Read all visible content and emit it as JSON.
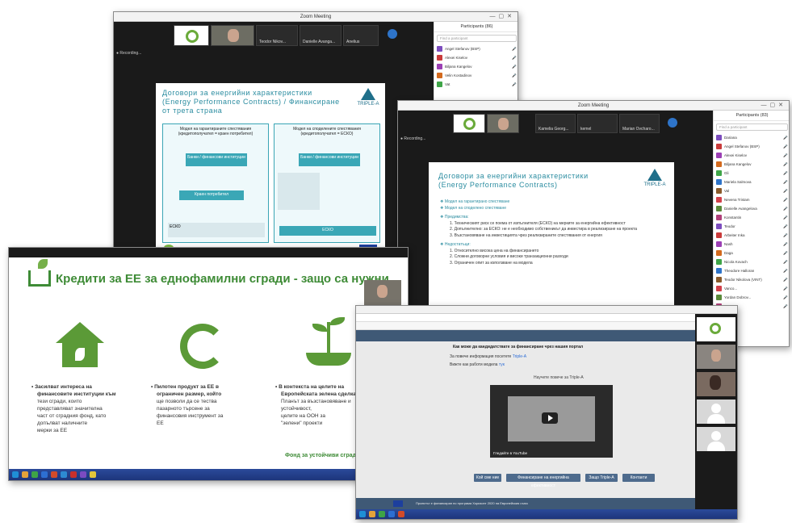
{
  "window_title": "Zoom Meeting",
  "win1": {
    "thumbs": [
      "",
      "",
      "Teodor Nikov...",
      "Danielle Avanga...",
      "Anelius"
    ],
    "recording": "Recording...",
    "participants_title": "Participants (86)",
    "search_placeholder": "Find a participant",
    "participants": [
      "Angel Stefanov (BSP)",
      "Alexei Kiselov",
      "Biljana Kangelov",
      "Velin Kostadinov",
      "Vat"
    ],
    "slide_title_1": "Договори за енергийни характеристики",
    "slide_title_2": "(Energy Performance Contracts) / Финансиране",
    "slide_title_3": "от трета страна",
    "logo": "TRIPLE-A",
    "model_left": "Модел на гарантираните спестявания (кредитополучател = краен потребител)",
    "model_right": "Модел на споделените спестявания (кредитополучател = ЕСКО)",
    "bank_label": "Банки / финансови институции",
    "end_user": "Краен потребител",
    "esco": "ЕСКО",
    "esco2": "ЕСКО"
  },
  "win2": {
    "thumbs": [
      "",
      "Kamelia Georg...",
      "kemel",
      "Marian Ovcharo..."
    ],
    "recording": "Recording...",
    "participants_title": "Participants (83)",
    "search_placeholder": "Find a participant",
    "participants": [
      "Dariana",
      "Angel Stefanov (BSP)",
      "Alexei Kiselov",
      "Biljana Kangelov",
      "Gli",
      "Mariela Salmova",
      "Val",
      "Nevena Tristam",
      "Danielle Avangelova",
      "Konstantin",
      "Teodor",
      "Arbeiter Inka",
      "Nash",
      "Daga",
      "Nicola Kovach",
      "Theodore Halloran",
      "Teodor Nikolova (VINT)",
      "Vanco...",
      "Yordan Dobrov...",
      "Tanya"
    ],
    "slide_title_1": "Договори за енергийни характеристики",
    "slide_title_2": "(Energy Performance Contracts)",
    "logo": "TRIPLE-A",
    "bullets_a": [
      "Модел на гарантирано спестяване",
      "Модел на споделено спестяване"
    ],
    "adv_head": "Предимства:",
    "adv": [
      "Техническият риск се поема от изпълнителя (ЕСКО) на мерките за енергийна ефективност",
      "Допълнително: за ЕСКО: не е необходимо собственикът да инвестира в реализиране на проекта",
      "Възстановяване на инвестицията чрез реализираните спестявания от енергия"
    ],
    "dis_head": "Недостатъци:",
    "dis": [
      "Относително висока цена на финансирането",
      "Сложни договорни условия и високи транзакционни разходи",
      "Ограничен опит за използване на модела"
    ]
  },
  "win3": {
    "title": "Кредити за ЕЕ за еднофамилни сгради - защо са нужни",
    "col1": [
      "Засилват интереса на",
      "финансовите институции към",
      "тези сгради, които",
      "представляват значителна",
      "част от сградния фонд, като",
      "допълват наличните",
      "мерки за ЕЕ"
    ],
    "col2": [
      "Пилотен продукт за ЕЕ в",
      "ограничен размер, който",
      "ще позволи да се тества",
      "пазарното търсене за",
      "финансовия инструмент за",
      "ЕЕ"
    ],
    "col3": [
      "В контекста на целите на",
      "Европейската зелена сделка",
      "Планът за възстановяване и",
      "устойчивост,",
      "целите на ООН за",
      "\"зелени\" проекти"
    ],
    "col3_foot": "Фонд за устойчиви сгради"
  },
  "win4": {
    "heading_line": "Как може да кандидатствате за финансиране чрез нашия портал",
    "line2": "За повече информация посетете",
    "line3": "Вижте как работи модела",
    "video_label": "Научете повече за Triple-A",
    "video_bar": "Гледайте в YouTube",
    "buttons": [
      "Кой сме ние",
      "Финансиране на енергийна ефективност",
      "Защо Triple-A",
      "Контакти"
    ],
    "footer": "Проектът е финансиран по програма Хоризонт 2020 на Европейския съюз"
  },
  "colors": {
    "teal": "#3aa7b6",
    "green": "#3e8b36",
    "zoom_dark": "#1a1a1a"
  }
}
